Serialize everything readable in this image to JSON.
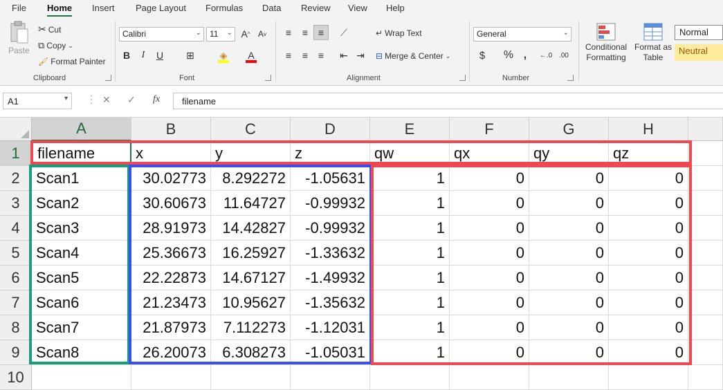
{
  "menu": [
    "File",
    "Home",
    "Insert",
    "Page Layout",
    "Formulas",
    "Data",
    "Review",
    "View",
    "Help"
  ],
  "clipboard": {
    "paste": "Paste",
    "cut": "Cut",
    "copy": "Copy",
    "format_painter": "Format Painter",
    "label": "Clipboard"
  },
  "font": {
    "name": "Calibri",
    "size": "11",
    "label": "Font"
  },
  "alignment": {
    "wrap": "Wrap Text",
    "merge": "Merge & Center",
    "label": "Alignment"
  },
  "number": {
    "format": "General",
    "label": "Number"
  },
  "styles": {
    "conditional": "Conditional",
    "conditional2": "Formatting",
    "format_table": "Format as",
    "format_table2": "Table",
    "normal": "Normal",
    "neutral": "Neutral"
  },
  "formula_bar": {
    "name_box": "A1",
    "fx": "fx",
    "content": "filename"
  },
  "columns": [
    "A",
    "B",
    "C",
    "D",
    "E",
    "F",
    "G",
    "H"
  ],
  "rows": [
    "1",
    "2",
    "3",
    "4",
    "5",
    "6",
    "7",
    "8",
    "9",
    "10"
  ],
  "header": [
    "filename",
    "x",
    "y",
    "z",
    "qw",
    "qx",
    "qy",
    "qz"
  ],
  "data": [
    [
      "Scan1",
      "30.02773",
      "8.292272",
      "-1.05631",
      "1",
      "0",
      "0",
      "0"
    ],
    [
      "Scan2",
      "30.60673",
      "11.64727",
      "-0.99932",
      "1",
      "0",
      "0",
      "0"
    ],
    [
      "Scan3",
      "28.91973",
      "14.42827",
      "-0.99932",
      "1",
      "0",
      "0",
      "0"
    ],
    [
      "Scan4",
      "25.36673",
      "16.25927",
      "-1.33632",
      "1",
      "0",
      "0",
      "0"
    ],
    [
      "Scan5",
      "22.22873",
      "14.67127",
      "-1.49932",
      "1",
      "0",
      "0",
      "0"
    ],
    [
      "Scan6",
      "21.23473",
      "10.95627",
      "-1.35632",
      "1",
      "0",
      "0",
      "0"
    ],
    [
      "Scan7",
      "21.87973",
      "7.112273",
      "-1.12031",
      "1",
      "0",
      "0",
      "0"
    ],
    [
      "Scan8",
      "26.20073",
      "6.308273",
      "-1.05031",
      "1",
      "0",
      "0",
      "0"
    ]
  ],
  "colors": {
    "red": "#f04850",
    "green": "#14a07a",
    "blue": "#3a4ff0",
    "excel_green": "#217346",
    "neutral_bg": "#ffeb9c",
    "neutral_text": "#9c5700"
  }
}
